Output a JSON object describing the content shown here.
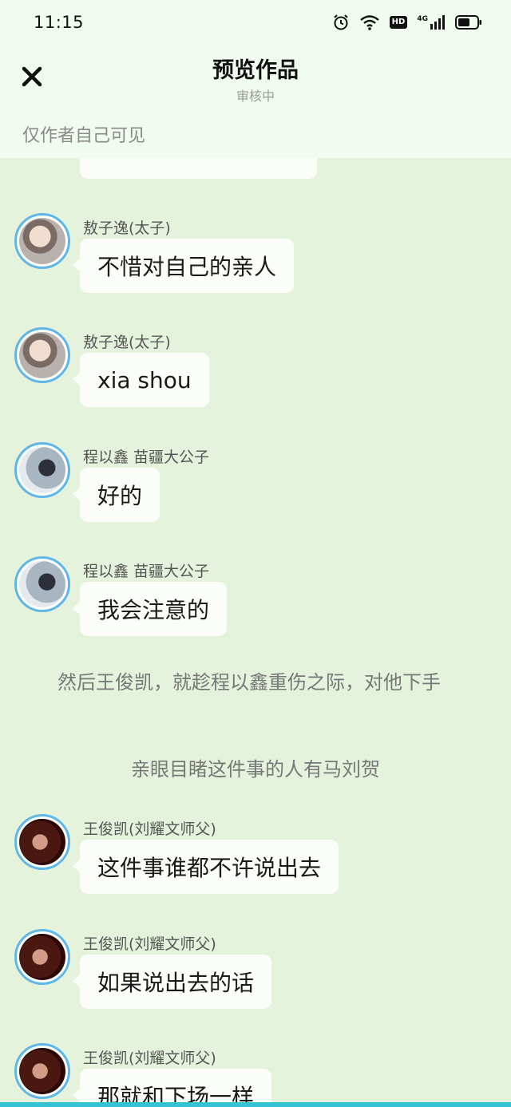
{
  "status_bar": {
    "time": "11:15",
    "icons": [
      "alarm-icon",
      "wifi-icon",
      "hd-icon",
      "signal-4g-icon",
      "battery-icon"
    ],
    "hd_label": "HD",
    "network_label": "4G"
  },
  "header": {
    "title": "预览作品",
    "subtitle": "审核中",
    "visibility_note": "仅作者自己可见",
    "close_icon": "close-icon"
  },
  "messages": [
    {
      "type": "chat",
      "sender": "敖子逸(太子)",
      "text": "不惜对自己的亲人",
      "avatar": "avatar-aozi"
    },
    {
      "type": "chat",
      "sender": "敖子逸(太子)",
      "text": "xia shou",
      "avatar": "avatar-aozi"
    },
    {
      "type": "chat",
      "sender": "程以鑫 苗疆大公子",
      "text": "好的",
      "avatar": "avatar-cheng"
    },
    {
      "type": "chat",
      "sender": "程以鑫 苗疆大公子",
      "text": "我会注意的",
      "avatar": "avatar-cheng"
    },
    {
      "type": "narration",
      "text": "然后王俊凯，就趁程以鑫重伤之际，对他下手"
    },
    {
      "type": "narration",
      "text": "亲眼目睹这件事的人有马刘贺"
    },
    {
      "type": "chat",
      "sender": "王俊凯(刘耀文师父)",
      "text": "这件事谁都不许说出去",
      "avatar": "avatar-wang"
    },
    {
      "type": "chat",
      "sender": "王俊凯(刘耀文师父)",
      "text": "如果说出去的话",
      "avatar": "avatar-wang"
    },
    {
      "type": "chat",
      "sender": "王俊凯(刘耀文师父)",
      "text": "那就和下场一样",
      "avatar": "avatar-wang"
    }
  ],
  "colors": {
    "background": "#e5f3dc",
    "header_background": "#f2fbef",
    "bubble": "#fbfdf9",
    "avatar_border": "#5fb6e8",
    "home_bar": "#34c3d3"
  }
}
